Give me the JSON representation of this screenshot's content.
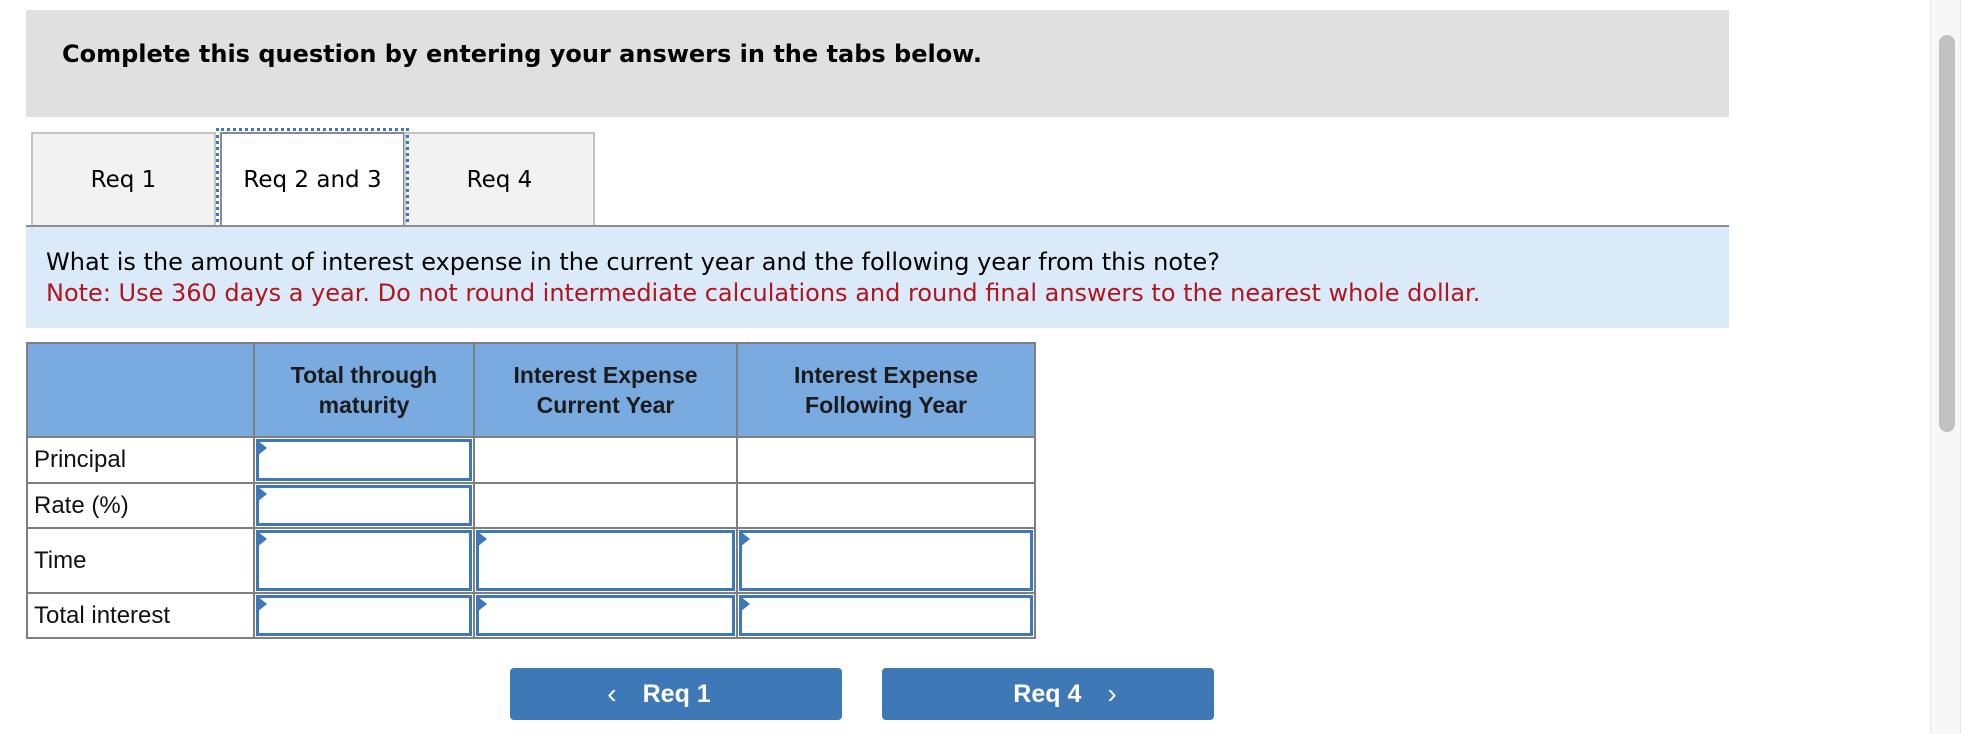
{
  "header": {
    "title": "Complete this question by entering your answers in the tabs below."
  },
  "tabs": [
    {
      "label": "Req 1",
      "active": false
    },
    {
      "label": "Req 2 and 3",
      "active": true
    },
    {
      "label": "Req 4",
      "active": false
    }
  ],
  "question": {
    "text": "What is the amount of interest expense in the current year and the following year from this note?",
    "note": "Note: Use 360 days a year. Do not round intermediate calculations and round final answers to the nearest whole dollar."
  },
  "table": {
    "columns": [
      "",
      "Total through maturity",
      "Interest Expense Current Year",
      "Interest Expense Following Year"
    ],
    "column_lines": [
      [
        "Total through",
        "maturity"
      ],
      [
        "Interest Expense",
        "Current Year"
      ],
      [
        "Interest Expense",
        "Following Year"
      ]
    ],
    "rows": [
      {
        "label": "Principal",
        "values": [
          "",
          null,
          null
        ]
      },
      {
        "label": "Rate (%)",
        "values": [
          "",
          null,
          null
        ]
      },
      {
        "label": "Time",
        "values": [
          "",
          "",
          ""
        ]
      },
      {
        "label": "Total interest",
        "values": [
          "",
          "",
          ""
        ]
      }
    ]
  },
  "nav": {
    "prev_label": "Req 1",
    "prev_icon": "chevron-left-icon",
    "next_label": "Req 4",
    "next_icon": "chevron-right-icon"
  },
  "colors": {
    "accent": "#3e78b6",
    "table_header": "#7aabe0",
    "band": "#dbeaf8",
    "note_red": "#b3141e"
  }
}
